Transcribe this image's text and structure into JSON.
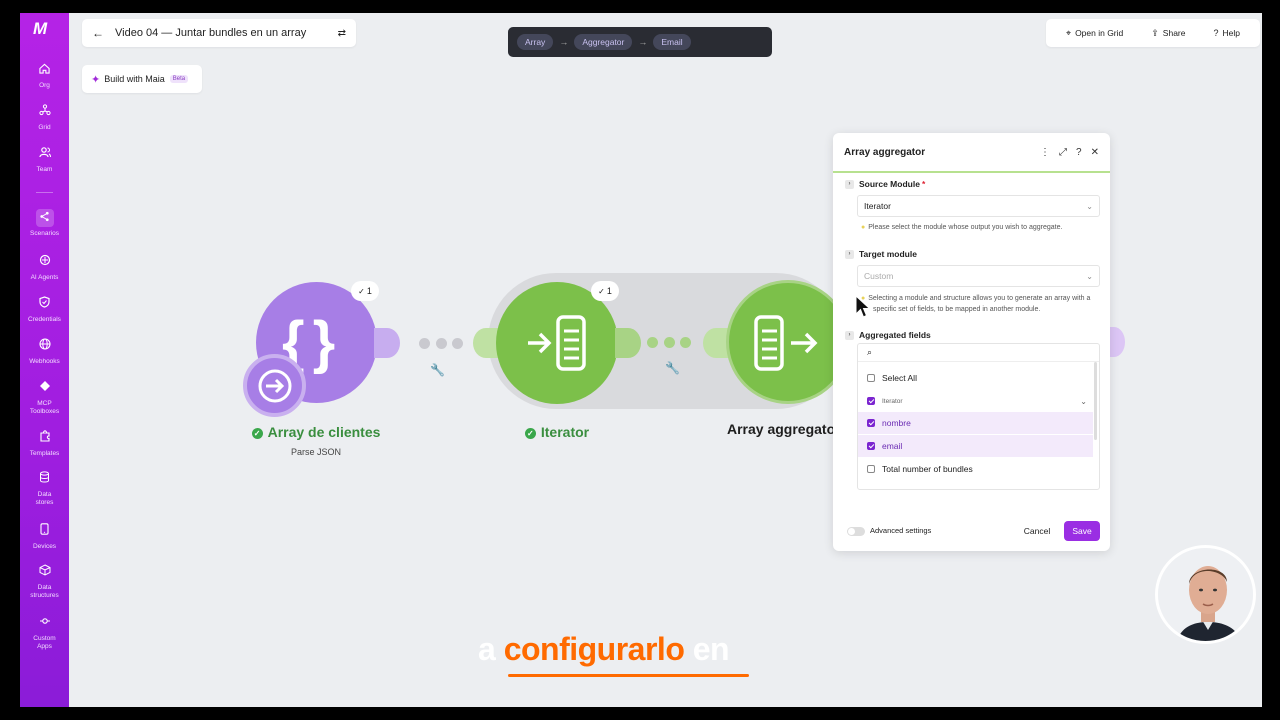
{
  "sidebar": {
    "logo": "M",
    "items": [
      {
        "label": "Org",
        "icon": "home-icon"
      },
      {
        "label": "Grid",
        "icon": "grid-icon"
      },
      {
        "label": "Team",
        "icon": "team-icon"
      },
      {
        "label": "Scenarios",
        "icon": "share-nodes-icon"
      },
      {
        "label": "AI Agents",
        "icon": "ai-agent-icon"
      },
      {
        "label": "Credentials",
        "icon": "shield-icon"
      },
      {
        "label": "Webhooks",
        "icon": "globe-icon"
      },
      {
        "label": "MCP Toolboxes",
        "icon": "toolbox-icon"
      },
      {
        "label": "Templates",
        "icon": "puzzle-icon"
      },
      {
        "label": "Data stores",
        "icon": "database-icon"
      },
      {
        "label": "Devices",
        "icon": "phone-icon"
      },
      {
        "label": "Data structures",
        "icon": "cube-icon"
      },
      {
        "label": "Custom Apps",
        "icon": "custom-app-icon"
      }
    ]
  },
  "header": {
    "title": "Video 04 — Juntar bundles en un array",
    "maia_label": "Build with Maia",
    "maia_badge": "Beta",
    "breadcrumb": [
      "Array",
      "Aggregator",
      "Email"
    ],
    "open_in_grid": "Open in Grid",
    "share": "Share",
    "help": "Help"
  },
  "canvas": {
    "modules": [
      {
        "name": "Array de clientes",
        "subtitle": "Parse JSON",
        "badge": "1",
        "color": "#a77ee6"
      },
      {
        "name": "Iterator",
        "subtitle": "",
        "badge": "1",
        "color": "#7cc04a"
      },
      {
        "name": "Array aggregato",
        "subtitle": "",
        "color": "#7cc04a"
      }
    ]
  },
  "panel": {
    "title": "Array aggregator",
    "source_label": "Source Module",
    "source_required": "*",
    "source_value": "Iterator",
    "source_help": "Please select the module whose output you wish to aggregate.",
    "target_label": "Target module",
    "target_value": "Custom",
    "target_help": "Selecting a module and structure allows you to generate an array with a specific set of fields, to be mapped in another module.",
    "aggregated_label": "Aggregated fields",
    "fields": [
      {
        "label": "Select All",
        "checked": false
      },
      {
        "label": "Iterator",
        "checked": true,
        "group": true
      },
      {
        "label": "nombre",
        "checked": true
      },
      {
        "label": "email",
        "checked": true
      },
      {
        "label": "Total number of bundles",
        "checked": false
      }
    ],
    "advanced_label": "Advanced settings",
    "cancel": "Cancel",
    "save": "Save"
  },
  "caption": {
    "pre": "a",
    "highlight": "configurarlo",
    "post": "en"
  },
  "colors": {
    "brand": "#a01ee0",
    "accent_orange": "#ff6a00",
    "green": "#7cc04a",
    "purple_module": "#a77ee6"
  }
}
